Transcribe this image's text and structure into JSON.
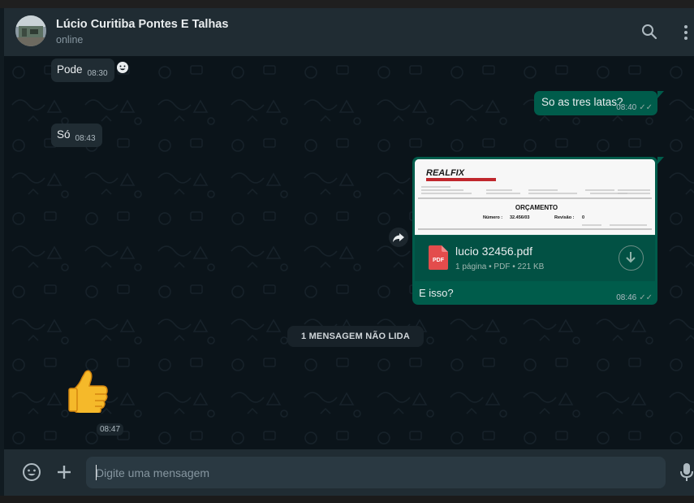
{
  "header": {
    "contact_name": "Lúcio Curitiba Pontes E Talhas",
    "status": "online"
  },
  "messages": {
    "m1": {
      "text": "Pode",
      "time": "08:30"
    },
    "m2": {
      "text": "So as tres latas?",
      "time": "08:40",
      "ticks": "✓✓"
    },
    "m3": {
      "text": "Só",
      "time": "08:43"
    },
    "m4": {
      "preview": {
        "brand": "REALFIX",
        "title": "ORÇAMENTO",
        "numero_label": "Número :",
        "numero": "32.456/03",
        "revisao_label": "Revisão :",
        "revisao": "0"
      },
      "file_name": "lucio 32456.pdf",
      "file_meta": "1 página • PDF • 221 KB",
      "pdf_badge": "PDF",
      "caption": "E isso?",
      "time": "08:46",
      "ticks": "✓✓"
    },
    "m5": {
      "emoji": "👍",
      "time": "08:47"
    }
  },
  "unread_divider": "1 MENSAGEM NÃO LIDA",
  "composer": {
    "placeholder": "Digite uma mensagem"
  },
  "colors": {
    "outgoing_bubble": "#005c4b",
    "incoming_bubble": "#202c33",
    "header_bg": "#202c33",
    "chat_bg": "#0b141a"
  },
  "icons": {
    "search": "search-icon",
    "menu": "kebab-menu-icon",
    "reaction": "smiley-reaction-icon",
    "forward": "forward-icon",
    "download": "download-icon",
    "emoji": "emoji-icon",
    "attach": "plus-icon",
    "mic": "microphone-icon"
  }
}
